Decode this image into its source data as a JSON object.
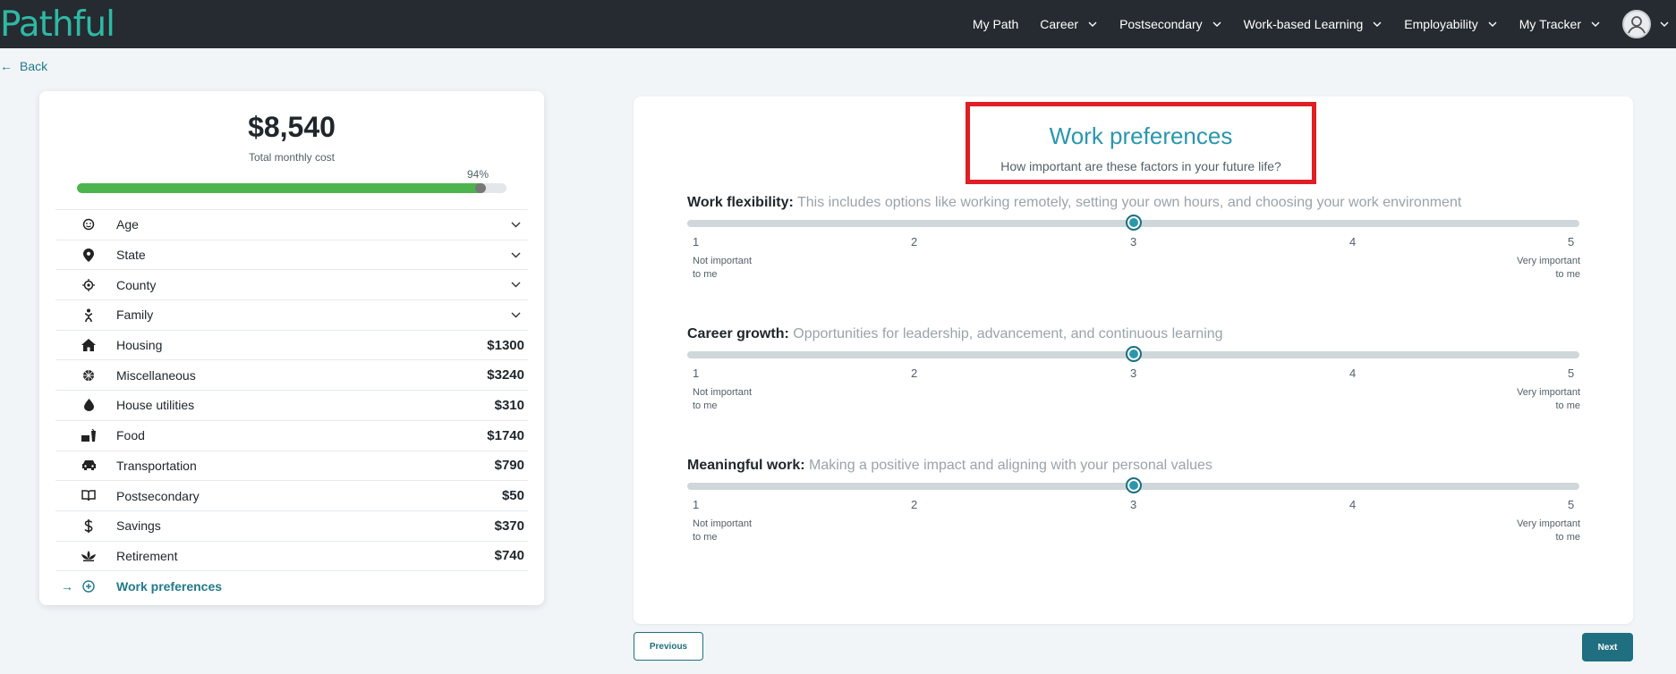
{
  "app": {
    "logo": "Pathful"
  },
  "nav": {
    "items": [
      {
        "label": "My Path",
        "dropdown": false
      },
      {
        "label": "Career",
        "dropdown": true
      },
      {
        "label": "Postsecondary",
        "dropdown": true
      },
      {
        "label": "Work-based Learning",
        "dropdown": true
      },
      {
        "label": "Employability",
        "dropdown": true
      },
      {
        "label": "My Tracker",
        "dropdown": true
      }
    ]
  },
  "back": {
    "label": "Back"
  },
  "summary": {
    "total": "$8,540",
    "total_label": "Total monthly cost",
    "progress_label": "94%",
    "progress": 0.94,
    "progress_color": "#4cb44c",
    "rows": [
      {
        "icon": "face-icon",
        "label": "Age",
        "expandable": true,
        "value": ""
      },
      {
        "icon": "map-pin-icon",
        "label": "State",
        "expandable": true,
        "value": ""
      },
      {
        "icon": "target-icon",
        "label": "County",
        "expandable": true,
        "value": ""
      },
      {
        "icon": "family-icon",
        "label": "Family",
        "expandable": true,
        "value": ""
      },
      {
        "icon": "house-icon",
        "label": "Housing",
        "expandable": false,
        "value": "$1300"
      },
      {
        "icon": "ball-icon",
        "label": "Miscellaneous",
        "expandable": false,
        "value": "$3240"
      },
      {
        "icon": "drop-icon",
        "label": "House utilities",
        "expandable": false,
        "value": "$310"
      },
      {
        "icon": "food-icon",
        "label": "Food",
        "expandable": false,
        "value": "$1740"
      },
      {
        "icon": "car-icon",
        "label": "Transportation",
        "expandable": false,
        "value": "$790"
      },
      {
        "icon": "book-icon",
        "label": "Postsecondary",
        "expandable": false,
        "value": "$50"
      },
      {
        "icon": "dollar-icon",
        "label": "Savings",
        "expandable": false,
        "value": "$370"
      },
      {
        "icon": "lotus-icon",
        "label": "Retirement",
        "expandable": false,
        "value": "$740"
      }
    ],
    "active_row": {
      "label": "Work preferences"
    }
  },
  "panel": {
    "title": "Work preferences",
    "subtitle": "How important are these factors in your future life?",
    "scale": [
      "1",
      "2",
      "3",
      "4",
      "5"
    ],
    "low_label": [
      "Not important",
      "to me"
    ],
    "high_label": [
      "Very important",
      "to me"
    ],
    "questions": [
      {
        "heading": "Work flexibility:",
        "description": " This includes options like working remotely, setting your own hours, and choosing your work environment",
        "value": 3
      },
      {
        "heading": "Career growth:",
        "description": " Opportunities for leadership, advancement, and continuous learning",
        "value": 3
      },
      {
        "heading": "Meaningful work:",
        "description": " Making a positive impact and aligning with your personal values",
        "value": 3
      }
    ],
    "accent_color": "#2a97ad",
    "highlight_color": "#e01e24"
  },
  "buttons": {
    "previous": "Previous",
    "next": "Next"
  }
}
